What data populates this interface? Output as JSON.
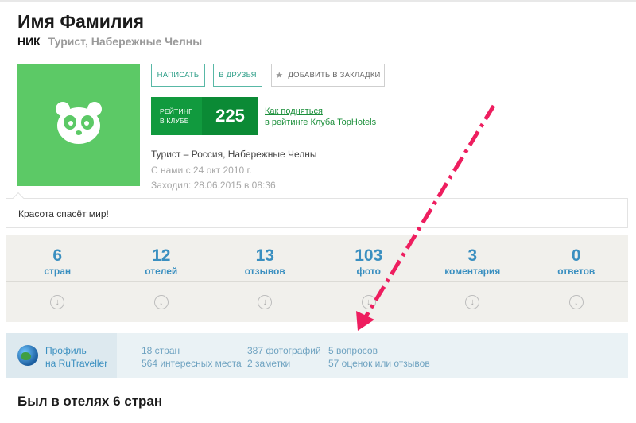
{
  "profile": {
    "name": "Имя Фамилия",
    "nick": "НИК",
    "subinfo": "Турист, Набережные Челны",
    "location_line": "Турист – Россия, Набережные Челны",
    "member_since": "С нами с 24 окт 2010 г.",
    "last_visit": "Заходил: 28.06.2015 в 08:36",
    "status": "Красота спасёт мир!"
  },
  "actions": {
    "write": "НАПИСАТЬ",
    "friends": "В ДРУЗЬЯ",
    "bookmark": "ДОБАВИТЬ В ЗАКЛАДКИ"
  },
  "rating": {
    "label_line1": "РЕЙТИНГ",
    "label_line2": "В КЛУБЕ",
    "value": "225",
    "link_line1": "Как подняться",
    "link_line2": "в рейтинге Клуба TopHotels"
  },
  "stats": [
    {
      "value": "6",
      "label": "стран"
    },
    {
      "value": "12",
      "label": "отелей"
    },
    {
      "value": "13",
      "label": "отзывов"
    },
    {
      "value": "103",
      "label": "фото"
    },
    {
      "value": "3",
      "label": "коментария"
    },
    {
      "value": "0",
      "label": "ответов"
    }
  ],
  "rutraveller": {
    "title_line1": "Профиль",
    "title_line2": "на RuTraveller",
    "col1_line1": "18 стран",
    "col1_line2": "564 интересных места",
    "col2_line1": "387 фотографий",
    "col2_line2": "2 заметки",
    "col3_line1": "5 вопросов",
    "col3_line2": "57 оценок или отзывов"
  },
  "section": {
    "title": "Был в отелях 6 стран"
  },
  "colors": {
    "avatar_bg": "#5cc966",
    "rating_bg": "#119a3e",
    "stat_blue": "#3a8fc0",
    "annotation_arrow": "#ee1e5f"
  },
  "icons": {
    "avatar": "panda-icon",
    "bookmark": "star-icon",
    "stat_expand": "arrow-down-circle-icon",
    "rutraveller": "globe-icon"
  }
}
